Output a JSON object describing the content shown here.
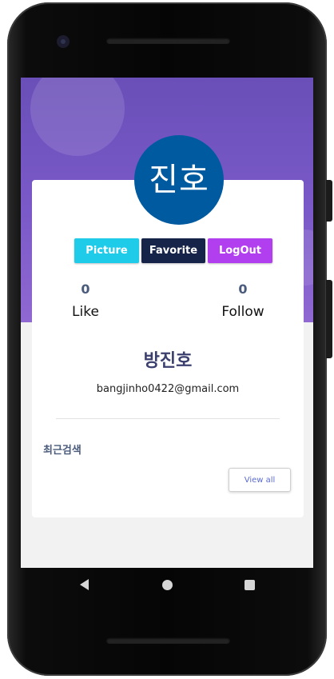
{
  "profile": {
    "avatar_text": "진호",
    "name": "방진호",
    "email": "bangjinho0422@gmail.com"
  },
  "actions": {
    "picture_label": "Picture",
    "favorite_label": "Favorite",
    "logout_label": "LogOut"
  },
  "stats": {
    "like": {
      "count": "0",
      "label": "Like"
    },
    "follow": {
      "count": "0",
      "label": "Follow"
    }
  },
  "recent": {
    "title": "최근검색",
    "view_all_label": "View all"
  },
  "colors": {
    "header": "#7a5ac8",
    "avatar_bg": "#005aa0",
    "picture_button": "#1ecbe9",
    "favorite_button": "#17244a",
    "logout_button": "#b13ff0"
  },
  "navigation": {
    "icons": [
      "back-icon",
      "home-icon",
      "recents-icon"
    ]
  }
}
